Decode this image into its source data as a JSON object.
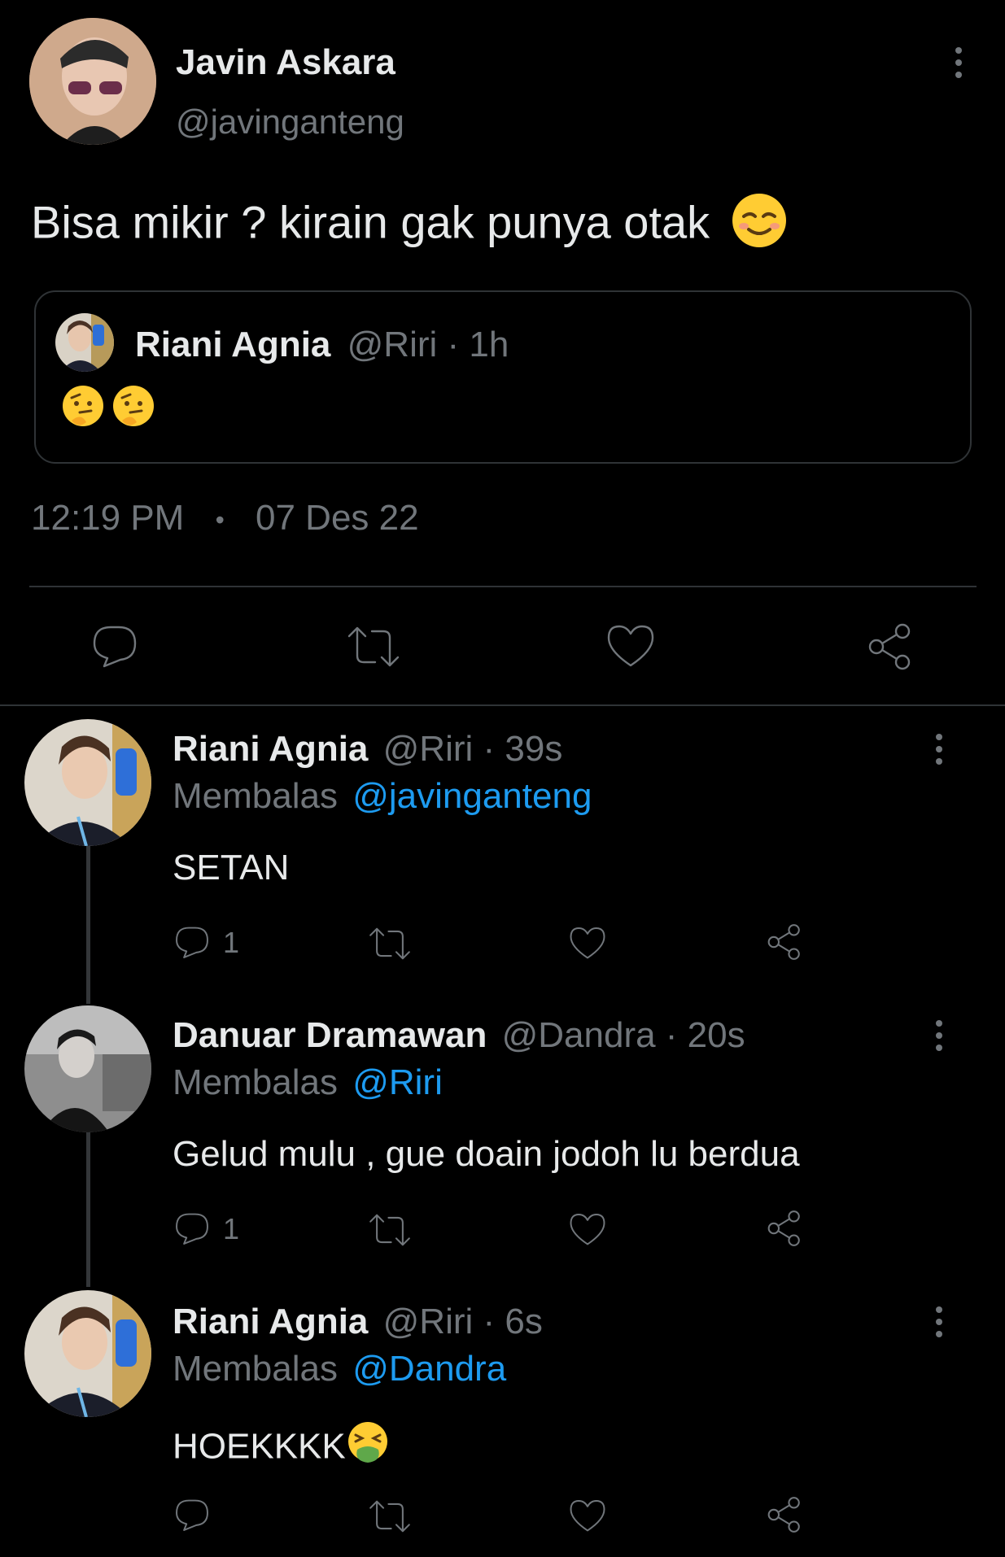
{
  "tweet": {
    "author_name": "Javin Askara",
    "author_handle": "@javinganteng",
    "text": "Bisa mikir ? kirain gak punya otak",
    "text_emoji": "relieved-face-emoji",
    "quote": {
      "author_name": "Riani Agnia",
      "meta": "@Riri · 1h",
      "emoji": "thinking-face-emoji x2"
    },
    "time": "12:19 PM",
    "separator": "•",
    "date": "07 Des 22"
  },
  "actions": {
    "reply": "reply-icon",
    "retweet": "retweet-icon",
    "like": "heart-icon",
    "share": "share-icon"
  },
  "replies": [
    {
      "author_name": "Riani Agnia",
      "meta": "@Riri · 39s",
      "replying_prefix": "Membalas",
      "replying_to": "@javinganteng",
      "text": "SETAN",
      "reply_count": "1"
    },
    {
      "author_name": "Danuar Dramawan",
      "meta": "@Dandra · 20s",
      "replying_prefix": "Membalas",
      "replying_to": "@Riri",
      "text": "Gelud mulu , gue doain jodoh lu berdua",
      "reply_count": "1"
    },
    {
      "author_name": "Riani Agnia",
      "meta": "@Riri · 6s",
      "replying_prefix": "Membalas",
      "replying_to": "@Dandra",
      "text": "HOEKKKK",
      "text_emoji": "vomiting-face-emoji",
      "reply_count": ""
    }
  ],
  "colors": {
    "background": "#000000",
    "text": "#e7e9ea",
    "muted": "#71767b",
    "link": "#1d9bf0"
  }
}
